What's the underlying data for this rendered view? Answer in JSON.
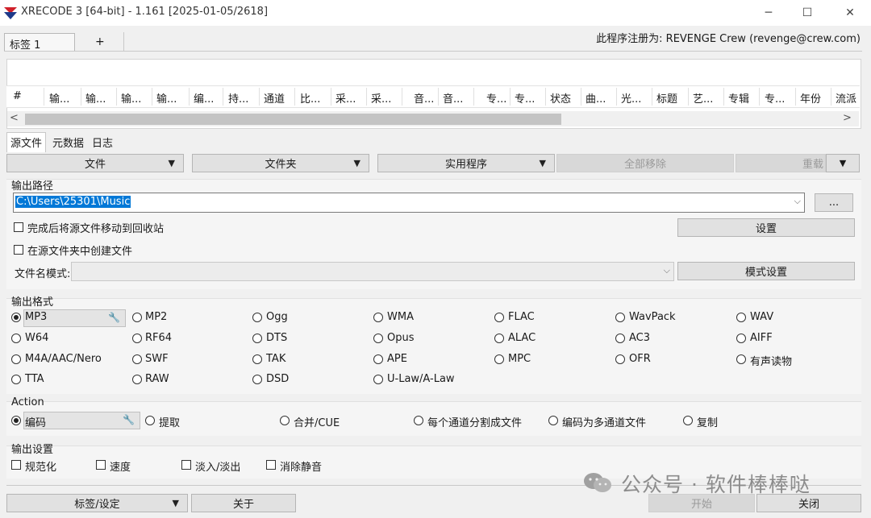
{
  "window": {
    "title": "XRECODE 3 [64-bit] - 1.161 [2025-01-05/2618]",
    "minimize_label": "─",
    "maximize_label": "☐",
    "close_label": "✕"
  },
  "tabs": {
    "active_label": "标签 1",
    "add_label": "+"
  },
  "registration": "此程序注册为: REVENGE Crew (revenge@crew.com)",
  "file_list": {
    "columns": [
      "#",
      "输...",
      "输...",
      "输...",
      "输...",
      "编...",
      "持...",
      "通道",
      "比...",
      "采...",
      "采...",
      "音...",
      "音...",
      "专...",
      "专...",
      "状态",
      "曲...",
      "光...",
      "标题",
      "艺...",
      "专辑",
      "专...",
      "年份",
      "流派"
    ],
    "scroll_left": "<",
    "scroll_right": ">"
  },
  "subtabs": [
    "源文件",
    "元数据",
    "日志"
  ],
  "actions": {
    "files": "文件",
    "folder": "文件夹",
    "utilities": "实用程序",
    "remove_all": "全部移除",
    "reload": "重载"
  },
  "output_path": {
    "title": "输出路径",
    "value": "C:\\Users\\25301\\Music",
    "browse": "...",
    "move_to_recycle": "完成后将源文件移动到回收站",
    "create_in_source": "在源文件夹中创建文件",
    "settings_button": "设置",
    "filename_mode_label": "文件名模式:",
    "filename_mode_value": "",
    "mode_settings_button": "模式设置"
  },
  "output_format": {
    "title": "输出格式",
    "selected": "MP3",
    "rows": [
      [
        "MP3",
        "MP2",
        "Ogg",
        "WMA",
        "FLAC",
        "WavPack",
        "WAV"
      ],
      [
        "W64",
        "RF64",
        "DTS",
        "Opus",
        "ALAC",
        "AC3",
        "AIFF"
      ],
      [
        "M4A/AAC/Nero",
        "SWF",
        "TAK",
        "APE",
        "MPC",
        "OFR",
        "有声读物"
      ],
      [
        "TTA",
        "RAW",
        "DSD",
        "U-Law/A-Law"
      ]
    ]
  },
  "action": {
    "title": "Action",
    "options": [
      "编码",
      "提取",
      "合并/CUE",
      "每个通道分割成文件",
      "编码为多通道文件",
      "复制"
    ]
  },
  "output_settings": {
    "title": "输出设置",
    "options": [
      "规范化",
      "速度",
      "淡入/淡出",
      "消除静音"
    ]
  },
  "footer": {
    "tags_settings": "标签/设定",
    "about": "关于",
    "start": "开始",
    "close": "关闭"
  },
  "watermark": "公众号 · 软件棒棒哒",
  "icons": {
    "caret": "▼",
    "wrench": "🔧",
    "dropdown_chevron": "⌵"
  },
  "colors": {
    "selection": "#0078d7",
    "logo_red": "#d0202a",
    "logo_blue": "#1e3a8a"
  }
}
